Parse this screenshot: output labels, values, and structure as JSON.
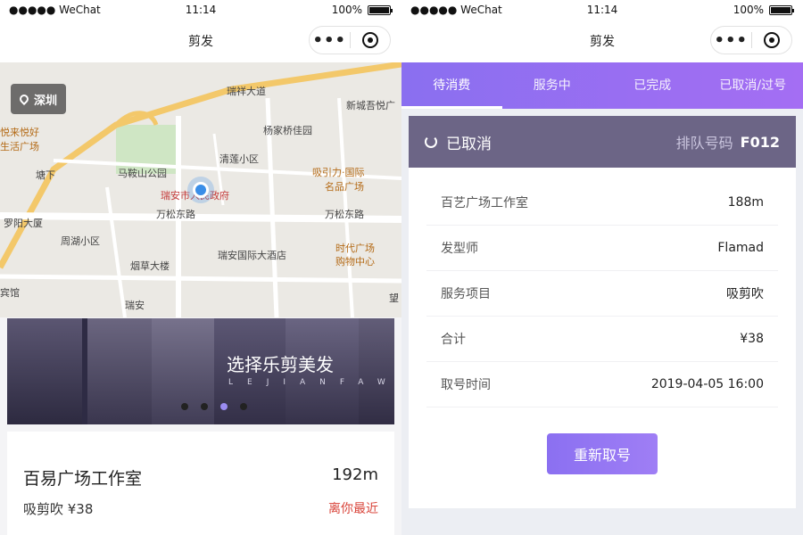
{
  "status_bar": {
    "carrier": "●●●●● WeChat",
    "time": "11:14",
    "battery": "100%"
  },
  "left": {
    "nav_title": "剪发",
    "capsule_more": "•••",
    "city": "深圳",
    "map_labels": [
      "瑞祥大道",
      "新城吾悦广",
      "杨家桥佳园",
      "马鞍山公园",
      "清莲小区",
      "吸引力·国际",
      "名品广场",
      "瑞安市人民政府",
      "万松东路",
      "万松东路",
      "罗阳大厦",
      "周湖小区",
      "瑞安国际大酒店",
      "时代广场",
      "购物中心",
      "烟草大楼",
      "生活广场",
      "悦来悦好",
      "塘下",
      "宾馆",
      "瑞安",
      "望"
    ],
    "banner": {
      "slogan": "选择乐剪美发",
      "sub": "LEJIANFAWU"
    },
    "shop": {
      "name": "百易广场工作室",
      "distance": "192m",
      "service": "吸剪吹 ¥38",
      "tag": "离你最近"
    }
  },
  "right": {
    "nav_title": "剪发",
    "capsule_more": "•••",
    "tabs": [
      "待消费",
      "服务中",
      "已完成",
      "已取消/过号"
    ],
    "order": {
      "status": "已取消",
      "queue_label": "排队号码",
      "queue_number": "F012",
      "rows": [
        {
          "key": "百艺广场工作室",
          "value": "188m"
        },
        {
          "key": "发型师",
          "value": "Flamad"
        },
        {
          "key": "服务项目",
          "value": "吸剪吹"
        },
        {
          "key": "合计",
          "value": "¥38"
        },
        {
          "key": "取号时间",
          "value": "2019-04-05 16:00"
        }
      ],
      "button": "重新取号"
    }
  },
  "colors": {
    "accent": "#8b70f1",
    "header": "#6c6586",
    "near_red": "#d9453b"
  },
  "icons": [
    "battery-icon",
    "more-icon",
    "target-icon",
    "location-pin-icon",
    "refresh-icon"
  ]
}
